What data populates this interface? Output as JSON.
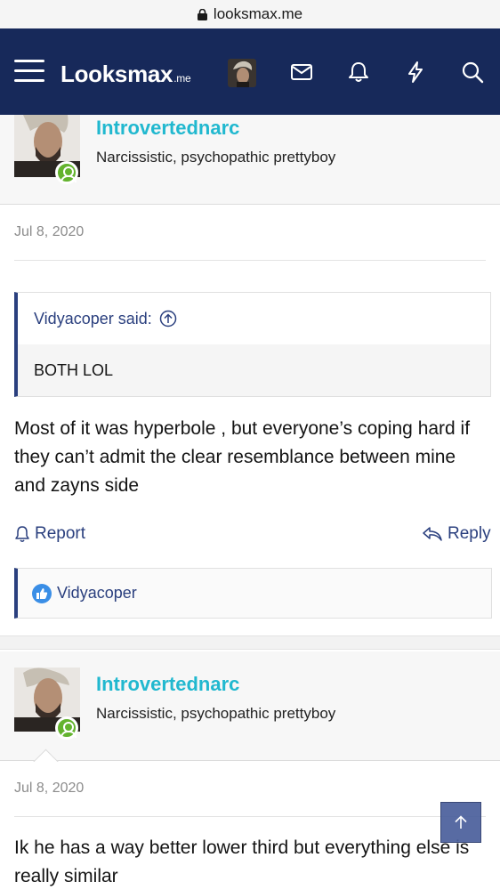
{
  "browser": {
    "url": "looksmax.me"
  },
  "header": {
    "logo_main": "Looksmax",
    "logo_suffix": ".me",
    "icons": [
      "menu-icon",
      "avatar",
      "envelope-icon",
      "bell-icon",
      "lightning-icon",
      "search-icon"
    ]
  },
  "colors": {
    "header_bg": "#17295a",
    "username": "#21b8cf",
    "link": "#2a3f7e",
    "online": "#63b32e"
  },
  "posts": [
    {
      "author": "Introvertednarc",
      "user_title": "Narcissistic, psychopathic prettyboy",
      "date": "Jul 8, 2020",
      "quote": {
        "author_line": "Vidyacoper said:",
        "text": "BOTH LOL"
      },
      "message": "Most of it was hyperbole , but everyone’s coping hard if they can’t admit the clear resemblance between mine and zayns side",
      "actions": {
        "report": "Report",
        "reply": "Reply"
      },
      "reactions": {
        "user": "Vidyacoper"
      }
    },
    {
      "author": "Introvertednarc",
      "user_title": "Narcissistic, psychopathic prettyboy",
      "date": "Jul 8, 2020",
      "message": "Ik he has a way better lower third but everything else is really similar"
    }
  ]
}
